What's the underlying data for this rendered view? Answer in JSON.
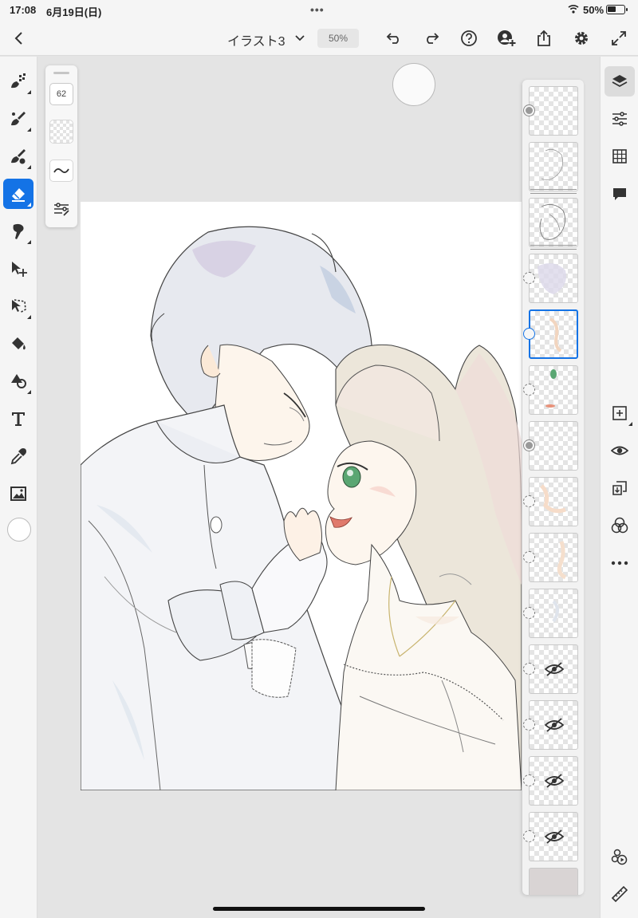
{
  "status_bar": {
    "time": "17:08",
    "date": "6月19日(日)",
    "dots": "•••",
    "battery_percent": "50%",
    "battery_level": 0.5
  },
  "toolbar": {
    "title": "イラスト3",
    "zoom": "50%",
    "icons": [
      "back-icon",
      "chevron-down-icon",
      "undo-icon",
      "redo-icon",
      "help-icon",
      "invite-icon",
      "share-icon",
      "gear-icon",
      "expand-icon"
    ]
  },
  "tools": [
    "pixel-brush-icon",
    "live-brush-icon",
    "vector-brush-icon",
    "eraser-icon",
    "smudge-icon",
    "transform-icon",
    "lasso-select-icon",
    "fill-icon",
    "shapes-icon",
    "text-icon",
    "eyedropper-icon",
    "image-icon"
  ],
  "active_tool": "eraser",
  "brush_panel": {
    "size": "62"
  },
  "current_color": "#ffffff",
  "accent_color": "#1473e6",
  "layers": {
    "selected_index": 4,
    "hidden_layer_indices": [
      10,
      11,
      12,
      13
    ]
  },
  "right_tools": [
    "layers-icon",
    "layer-properties-icon",
    "grid-icon",
    "comments-icon",
    "add-layer-icon",
    "visibility-icon",
    "merge-down-icon",
    "blend-mode-icon",
    "more-icon",
    "timelapse-icon",
    "ruler-icon"
  ]
}
